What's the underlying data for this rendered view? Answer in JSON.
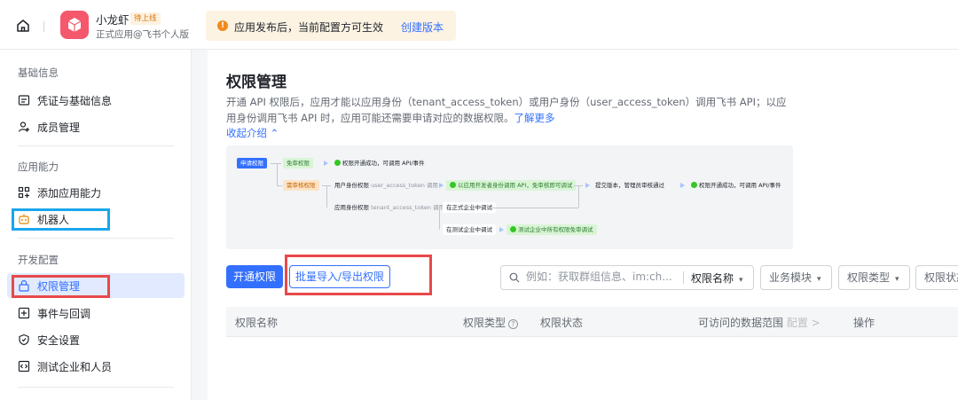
{
  "topbar": {
    "app_name": "小龙虾",
    "app_badge": "待上线",
    "app_sub": "正式应用@飞书个人版",
    "notice_text": "应用发布后，当前配置方可生效",
    "notice_link": "创建版本"
  },
  "sidebar": {
    "section_basic": "基础信息",
    "item_credentials": "凭证与基础信息",
    "item_members": "成员管理",
    "section_capability": "应用能力",
    "item_add_capability": "添加应用能力",
    "item_bot": "机器人",
    "section_dev": "开发配置",
    "item_permissions": "权限管理",
    "item_events": "事件与回调",
    "item_security": "安全设置",
    "item_test": "测试企业和人员"
  },
  "main": {
    "title": "权限管理",
    "desc": "开通 API 权限后，应用才能以应用身份（tenant_access_token）或用户身份（user_access_token）调用飞书 API；以应用身份调用飞书 API 时，应用可能还需要申请对应的数据权限。",
    "learn_more": "了解更多",
    "collapse": "收起介绍",
    "flow": {
      "apply": "申请权限",
      "no_review": "免审权限",
      "success1": "权限开通成功，可调用 API/事件",
      "need_review": "需审核权限",
      "user_perm": "用户身份权限",
      "user_token": "user_access_token 调用",
      "dev_call": "以应用开发者身份调用 API，免审核即可调试",
      "submit": "提交版本，管理员审核通过",
      "success2": "权限开通成功，可调用 API/事件",
      "app_perm": "应用身份权限",
      "tenant_token": "tenant_access_token 调用",
      "debug_formal": "在正式企业中调试",
      "debug_test": "在测试企业中调试",
      "test_free": "测试企业中所有权限免审调试"
    },
    "btn_enable": "开通权限",
    "btn_import": "批量导入/导出权限",
    "search": {
      "placeholder": "例如：获取群组信息、im:ch...",
      "type": "权限名称"
    },
    "filters": [
      "业务模块",
      "权限类型",
      "权限状态"
    ],
    "table_headers": {
      "name": "权限名称",
      "type": "权限类型",
      "status": "权限状态",
      "scope": "可访问的数据范围",
      "scope_config": "配置 >",
      "action": "操作"
    }
  }
}
